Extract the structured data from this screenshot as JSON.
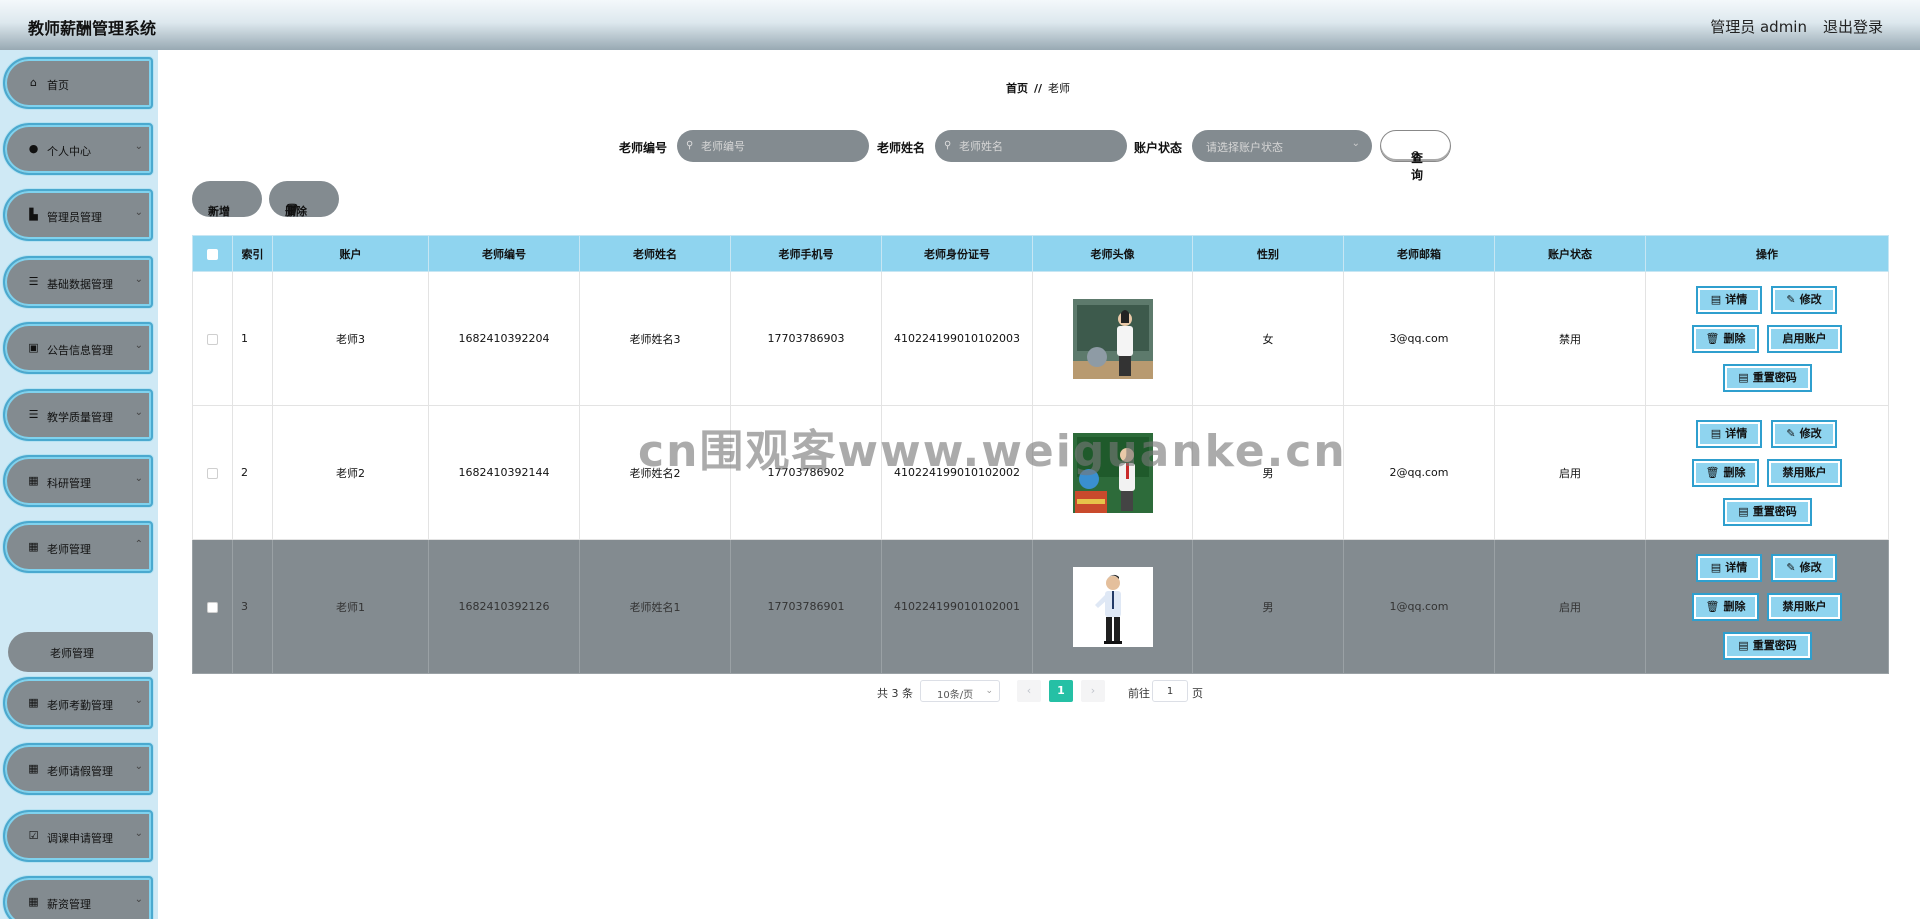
{
  "header": {
    "title": "教师薪酬管理系统",
    "user": "管理员 admin",
    "logout": "退出登录"
  },
  "sidebar": {
    "items": [
      {
        "label": "首页",
        "icon": "home-icon"
      },
      {
        "label": "个人中心",
        "icon": "user-icon"
      },
      {
        "label": "管理员管理",
        "icon": "chart-icon"
      },
      {
        "label": "基础数据管理",
        "icon": "list-icon"
      },
      {
        "label": "公告信息管理",
        "icon": "clipboard-icon"
      },
      {
        "label": "教学质量管理",
        "icon": "list-icon"
      },
      {
        "label": "科研管理",
        "icon": "grid-icon"
      },
      {
        "label": "老师管理",
        "icon": "table-icon"
      },
      {
        "label": "老师考勤管理",
        "icon": "grid-icon"
      },
      {
        "label": "老师请假管理",
        "icon": "grid-icon"
      },
      {
        "label": "调课申请管理",
        "icon": "check-icon"
      },
      {
        "label": "薪资管理",
        "icon": "grid-icon"
      }
    ],
    "sub_item": "老师管理"
  },
  "breadcrumb": {
    "home": "首页",
    "sep": "//",
    "current": "老师"
  },
  "search": {
    "teacher_no_label": "老师编号",
    "teacher_no_placeholder": "老师编号",
    "teacher_name_label": "老师姓名",
    "teacher_name_placeholder": "老师姓名",
    "status_label": "账户状态",
    "status_placeholder": "请选择账户状态",
    "query_label": "查询"
  },
  "actions": {
    "add": "新增",
    "delete": "删除"
  },
  "table": {
    "columns": [
      "索引",
      "账户",
      "老师编号",
      "老师姓名",
      "老师手机号",
      "老师身份证号",
      "老师头像",
      "性别",
      "老师邮箱",
      "账户状态",
      "操作"
    ],
    "rows": [
      {
        "index": "1",
        "account": "老师3",
        "teacher_no": "1682410392204",
        "name": "老师姓名3",
        "phone": "17703786903",
        "id_card": "410224199010102003",
        "gender": "女",
        "email": "3@qq.com",
        "status": "禁用",
        "toggle": "启用账户"
      },
      {
        "index": "2",
        "account": "老师2",
        "teacher_no": "1682410392144",
        "name": "老师姓名2",
        "phone": "17703786902",
        "id_card": "410224199010102002",
        "gender": "男",
        "email": "2@qq.com",
        "status": "启用",
        "toggle": "禁用账户"
      },
      {
        "index": "3",
        "account": "老师1",
        "teacher_no": "1682410392126",
        "name": "老师姓名1",
        "phone": "17703786901",
        "id_card": "410224199010102001",
        "gender": "男",
        "email": "1@qq.com",
        "status": "启用",
        "toggle": "禁用账户"
      }
    ],
    "op_labels": {
      "detail": "详情",
      "edit": "修改",
      "delete": "删除",
      "reset": "重置密码"
    }
  },
  "pagination": {
    "total": "共 3 条",
    "page_size": "10条/页",
    "current": "1",
    "goto": "前往",
    "goto_value": "1",
    "unit": "页"
  },
  "watermark": "cn围观客www.weiguanke.cn",
  "colors": {
    "accent_blue": "#8fd4ef",
    "gray": "#838b90",
    "pager_active": "#25c0a5",
    "sidebar_bg": "#cfe9f5"
  }
}
